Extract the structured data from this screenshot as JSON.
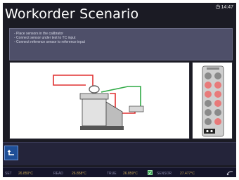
{
  "header": {
    "title": "Workorder Scenario",
    "time": "14:47"
  },
  "instructions": [
    "- Place sensors in the calibrator",
    "- Connect sensor under test to TC input",
    "- Connect reference sensor to reference input"
  ],
  "status": {
    "set_label": "SET",
    "set_value": "26.850°C",
    "read_label": "READ",
    "read_value": "26.858°C",
    "true_label": "TRUE",
    "true_value": "26.859°C",
    "sensor_label": "SENSOR",
    "sensor_value": "27.477°C"
  },
  "colors": {
    "background": "#1b1b24",
    "panel": "#4e4f69",
    "back_button": "#1e4e96",
    "wire_red": "#e03030",
    "wire_green": "#2faa45"
  },
  "icons": {
    "clock": "clock-icon",
    "back": "back-arrow-icon",
    "check": "check-icon",
    "sensor": "sensor-icon"
  }
}
